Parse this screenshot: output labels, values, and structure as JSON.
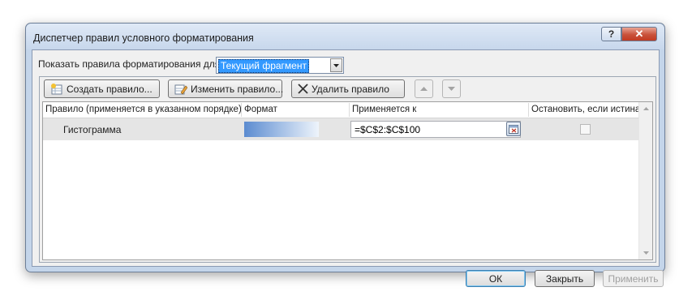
{
  "window": {
    "title": "Диспетчер правил условного форматирования",
    "help_label": "?",
    "close_label": "✕"
  },
  "filter": {
    "label": "Показать правила форматирования для:",
    "selected": "Текущий фрагмент"
  },
  "toolbar": {
    "create_label": "Создать правило...",
    "edit_label": "Изменить правило...",
    "delete_label": "Удалить правило"
  },
  "table": {
    "columns": [
      "Правило (применяется в указанном порядке)",
      "Формат",
      "Применяется к",
      "Остановить, если истина"
    ],
    "rows": [
      {
        "rule": "Гистограмма",
        "applies_to": "=$C$2:$C$100",
        "stop_if_true": false
      }
    ]
  },
  "buttons": {
    "ok": "ОК",
    "close": "Закрыть",
    "apply": "Применить"
  },
  "colors": {
    "selection": "#3399ff",
    "databar_start": "#5b8bd0",
    "frame": "#c4d5ea",
    "close_button": "#c9513a"
  }
}
